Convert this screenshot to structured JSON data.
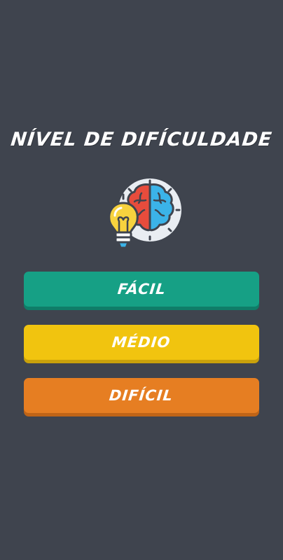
{
  "screen": {
    "title": "NÍVEL DE DIFÍCULDADE",
    "logo_icon": "lightbulb-brain-icon"
  },
  "buttons": {
    "facil": "FÁCIL",
    "medio": "MÉDIO",
    "dificil": "DIFÍCIL"
  },
  "colors": {
    "background": "#3f444e",
    "facil": "#16a085",
    "medio": "#f1c40f",
    "dificil": "#e67e22"
  }
}
